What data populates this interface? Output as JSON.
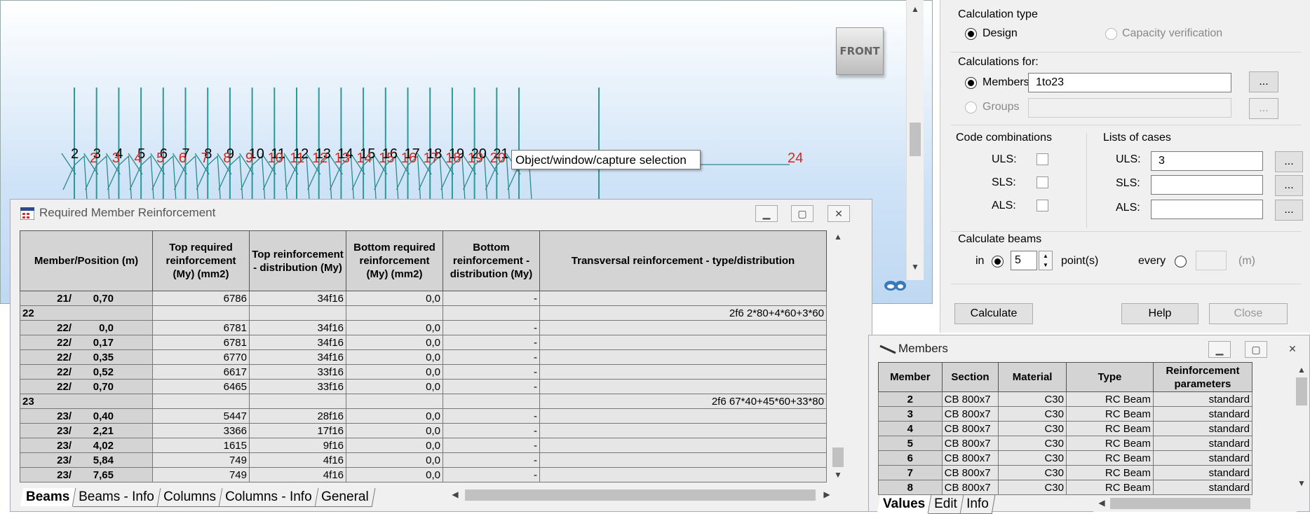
{
  "viewport": {
    "view_label": "FRONT",
    "tooltip": "Object/window/capture selection",
    "node_numbers_black": [
      "2",
      "3",
      "4",
      "5",
      "6",
      "7",
      "8",
      "9",
      "10",
      "11",
      "12",
      "13",
      "14",
      "15",
      "16",
      "17",
      "18",
      "19",
      "20",
      "21"
    ],
    "node_numbers_red": [
      "2",
      "3",
      "4",
      "5",
      "6",
      "7",
      "8",
      "9",
      "10",
      "11",
      "12",
      "13",
      "14",
      "15",
      "16",
      "17",
      "18",
      "19",
      "20",
      "24"
    ]
  },
  "reinforcement_window": {
    "title": "Required Member Reinforcement",
    "headers": [
      "Member/Position (m)",
      "Top required reinforcement (My) (mm2)",
      "Top reinforcement - distribution (My)",
      "Bottom required reinforcement (My) (mm2)",
      "Bottom reinforcement - distribution (My)",
      "Transversal reinforcement - type/distribution"
    ],
    "rows": [
      {
        "member": "21/",
        "pos": "0,70",
        "top_req": "6786",
        "top_dist": "34f16",
        "bot_req": "0,0",
        "bot_dist": "-",
        "trans": ""
      },
      {
        "member": "22",
        "pos": "",
        "top_req": "",
        "top_dist": "",
        "bot_req": "",
        "bot_dist": "",
        "trans": "2f6 2*80+4*60+3*60",
        "group": true
      },
      {
        "member": "22/",
        "pos": "0,0",
        "top_req": "6781",
        "top_dist": "34f16",
        "bot_req": "0,0",
        "bot_dist": "-",
        "trans": ""
      },
      {
        "member": "22/",
        "pos": "0,17",
        "top_req": "6781",
        "top_dist": "34f16",
        "bot_req": "0,0",
        "bot_dist": "-",
        "trans": ""
      },
      {
        "member": "22/",
        "pos": "0,35",
        "top_req": "6770",
        "top_dist": "34f16",
        "bot_req": "0,0",
        "bot_dist": "-",
        "trans": ""
      },
      {
        "member": "22/",
        "pos": "0,52",
        "top_req": "6617",
        "top_dist": "33f16",
        "bot_req": "0,0",
        "bot_dist": "-",
        "trans": ""
      },
      {
        "member": "22/",
        "pos": "0,70",
        "top_req": "6465",
        "top_dist": "33f16",
        "bot_req": "0,0",
        "bot_dist": "-",
        "trans": ""
      },
      {
        "member": "23",
        "pos": "",
        "top_req": "",
        "top_dist": "",
        "bot_req": "",
        "bot_dist": "",
        "trans": "2f6 67*40+45*60+33*80",
        "group": true
      },
      {
        "member": "23/",
        "pos": "0,40",
        "top_req": "5447",
        "top_dist": "28f16",
        "bot_req": "0,0",
        "bot_dist": "-",
        "trans": ""
      },
      {
        "member": "23/",
        "pos": "2,21",
        "top_req": "3366",
        "top_dist": "17f16",
        "bot_req": "0,0",
        "bot_dist": "-",
        "trans": ""
      },
      {
        "member": "23/",
        "pos": "4,02",
        "top_req": "1615",
        "top_dist": "9f16",
        "bot_req": "0,0",
        "bot_dist": "-",
        "trans": ""
      },
      {
        "member": "23/",
        "pos": "5,84",
        "top_req": "749",
        "top_dist": "4f16",
        "bot_req": "0,0",
        "bot_dist": "-",
        "trans": ""
      },
      {
        "member": "23/",
        "pos": "7,65",
        "top_req": "749",
        "top_dist": "4f16",
        "bot_req": "0,0",
        "bot_dist": "-",
        "trans": ""
      }
    ],
    "tabs": [
      "Beams",
      "Beams - Info",
      "Columns",
      "Columns - Info",
      "General"
    ]
  },
  "calc_panel": {
    "calc_type_label": "Calculation type",
    "design": "Design",
    "capacity": "Capacity verification",
    "calc_for_label": "Calculations for:",
    "members": "Members",
    "members_value": "1to23",
    "groups": "Groups",
    "ellipsis": "...",
    "code_comb_label": "Code combinations",
    "lists_label": "Lists of cases",
    "uls": "ULS:",
    "sls": "SLS:",
    "als": "ALS:",
    "uls_cases": "3",
    "calc_beams_label": "Calculate beams",
    "in": "in",
    "points_value": "5",
    "points": "point(s)",
    "every": "every",
    "unit_m": "(m)",
    "calculate": "Calculate",
    "help": "Help",
    "close": "Close"
  },
  "members_window": {
    "title": "Members",
    "headers": [
      "Member",
      "Section",
      "Material",
      "Type",
      "Reinforcement parameters"
    ],
    "rows": [
      {
        "member": "2",
        "section": "CB 800x7",
        "material": "C30",
        "type": "RC Beam",
        "params": "standard"
      },
      {
        "member": "3",
        "section": "CB 800x7",
        "material": "C30",
        "type": "RC Beam",
        "params": "standard"
      },
      {
        "member": "4",
        "section": "CB 800x7",
        "material": "C30",
        "type": "RC Beam",
        "params": "standard"
      },
      {
        "member": "5",
        "section": "CB 800x7",
        "material": "C30",
        "type": "RC Beam",
        "params": "standard"
      },
      {
        "member": "6",
        "section": "CB 800x7",
        "material": "C30",
        "type": "RC Beam",
        "params": "standard"
      },
      {
        "member": "7",
        "section": "CB 800x7",
        "material": "C30",
        "type": "RC Beam",
        "params": "standard"
      },
      {
        "member": "8",
        "section": "CB 800x7",
        "material": "C30",
        "type": "RC Beam",
        "params": "standard"
      }
    ],
    "tabs": [
      "Values",
      "Edit",
      "Info"
    ]
  }
}
